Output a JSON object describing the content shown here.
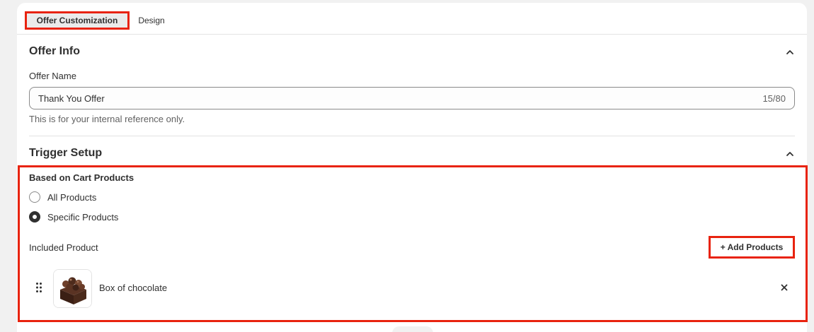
{
  "tabs": {
    "active_label": "Offer Customization",
    "design_label": "Design"
  },
  "offer_info": {
    "title": "Offer Info",
    "name_label": "Offer Name",
    "name_value": "Thank You Offer",
    "char_count": "15/80",
    "help_text": "This is for your internal reference only."
  },
  "trigger_setup": {
    "title": "Trigger Setup",
    "based_on_label": "Based on Cart Products",
    "options": [
      {
        "label": "All Products",
        "checked": false
      },
      {
        "label": "Specific Products",
        "checked": true
      }
    ],
    "included_label": "Included Product",
    "add_button_label": "+ Add Products",
    "products": [
      {
        "name": "Box of chocolate"
      }
    ]
  },
  "colors": {
    "highlight": "#e8230f",
    "text": "#303030",
    "muted": "#616161",
    "border": "#e3e3e3"
  },
  "icons": [
    "chevron-up-icon",
    "drag-handle-icon",
    "close-icon",
    "chocolate-box-image"
  ]
}
